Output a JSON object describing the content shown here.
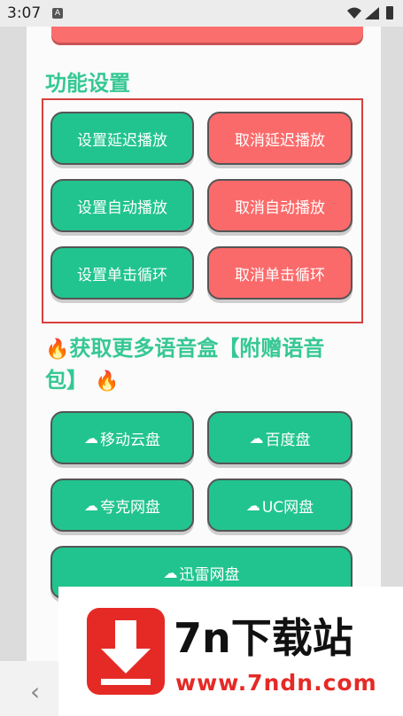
{
  "status_bar": {
    "time": "3:07",
    "app_icon": "A"
  },
  "settings": {
    "title": "功能设置",
    "buttons": [
      {
        "label": "设置延迟播放",
        "color": "#21c48e"
      },
      {
        "label": "取消延迟播放",
        "color": "#fb6a6a"
      },
      {
        "label": "设置自动播放",
        "color": "#21c48e"
      },
      {
        "label": "取消自动播放",
        "color": "#fb6a6a"
      },
      {
        "label": "设置单击循环",
        "color": "#21c48e"
      },
      {
        "label": "取消单击循环",
        "color": "#fb6a6a"
      }
    ]
  },
  "promo": {
    "title_text": "获取更多语音盒【附赠语音包】",
    "fire_icon": "🔥",
    "links": [
      {
        "label": "移动云盘",
        "icon": "cloud-icon"
      },
      {
        "label": "百度盘",
        "icon": "cloud-icon"
      },
      {
        "label": "夸克网盘",
        "icon": "cloud-icon"
      },
      {
        "label": "UC网盘",
        "icon": "cloud-icon"
      },
      {
        "label": "迅雷网盘",
        "icon": "cloud-icon"
      }
    ]
  },
  "watermark": {
    "title": "7n下载站",
    "url": "www.7ndn.com"
  },
  "colors": {
    "accent_green": "#21c48e",
    "accent_red": "#fb6a6a",
    "title_green": "#36c894"
  }
}
